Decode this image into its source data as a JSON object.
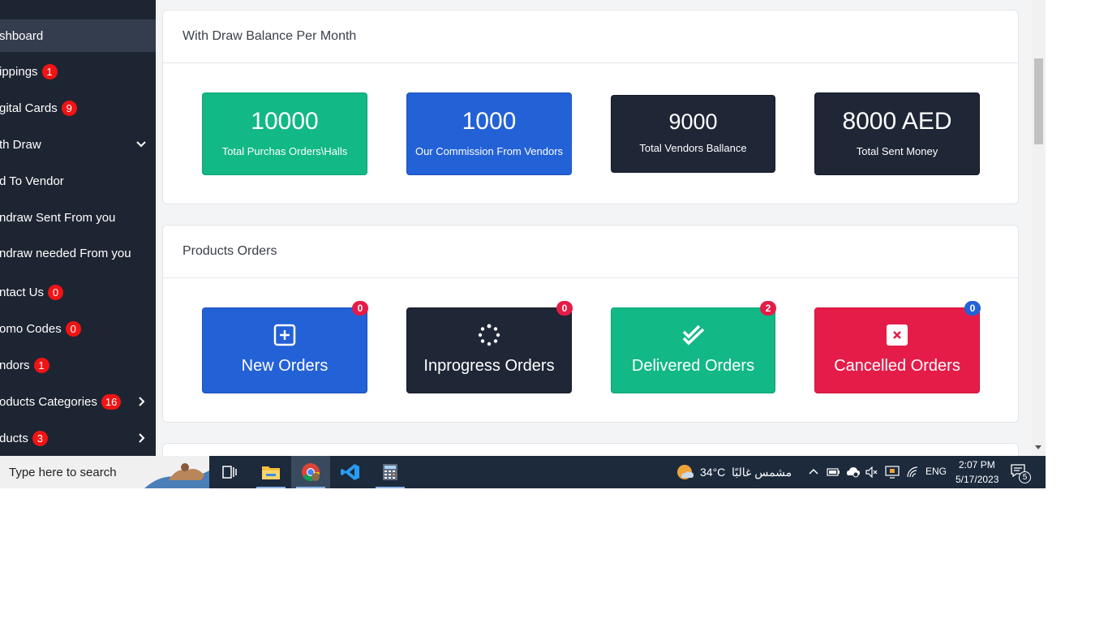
{
  "sidebar": {
    "items": [
      {
        "label": "shboard",
        "badge": "",
        "active": true,
        "chevron": ""
      },
      {
        "label": "ippings",
        "badge": "1",
        "chevron": ""
      },
      {
        "label": "gital Cards",
        "badge": "9",
        "chevron": ""
      },
      {
        "label": "th Draw",
        "badge": "",
        "chevron": "down"
      },
      {
        "label": "d To Vendor",
        "badge": "",
        "chevron": ""
      },
      {
        "label": "ndraw Sent From you",
        "badge": "",
        "chevron": ""
      },
      {
        "label": "ndraw needed From you",
        "badge": "",
        "chevron": ""
      },
      {
        "label": "ntact Us",
        "badge": "0",
        "chevron": ""
      },
      {
        "label": "omo Codes",
        "badge": "0",
        "chevron": ""
      },
      {
        "label": "ndors",
        "badge": "1",
        "chevron": ""
      },
      {
        "label": "oducts Categories",
        "badge": "16",
        "chevron": "right"
      },
      {
        "label": "ducts",
        "badge": "3",
        "chevron": "right"
      }
    ]
  },
  "withdraw": {
    "title": "With Draw Balance Per Month",
    "tiles": [
      {
        "value": "10000",
        "caption": "Total Purchas Orders\\Halls",
        "color": "green"
      },
      {
        "value": "1000",
        "caption": "Our Commission From Vendors",
        "color": "blue"
      },
      {
        "value": "9000",
        "caption": "Total Vendors Ballance",
        "color": "dark"
      },
      {
        "value": "8000 AED",
        "caption": "Total Sent Money",
        "color": "dark"
      }
    ]
  },
  "orders": {
    "title": "Products Orders",
    "tiles": [
      {
        "label": "New Orders",
        "count": "0",
        "color": "blue",
        "badge_color": "#e51c48",
        "icon": "plus-square-icon"
      },
      {
        "label": "Inprogress Orders",
        "count": "0",
        "color": "dark",
        "badge_color": "#e51c48",
        "icon": "spinner-icon"
      },
      {
        "label": "Delivered Orders",
        "count": "2",
        "color": "green",
        "badge_color": "#e51c48",
        "icon": "double-check-icon"
      },
      {
        "label": "Cancelled Orders",
        "count": "0",
        "color": "red",
        "badge_color": "#2361d6",
        "icon": "x-square-icon"
      }
    ]
  },
  "taskbar": {
    "search_placeholder": "Type here to search",
    "apps": [
      "task-view-icon",
      "file-explorer-icon",
      "chrome-icon",
      "vscode-icon",
      "calculator-icon"
    ],
    "weather_temp": "34°C",
    "weather_text": "مشمس غالبًا",
    "language": "ENG",
    "time": "2:07 PM",
    "date": "5/17/2023",
    "notification_count": "5"
  },
  "colors": {
    "sidebar_bg": "#1e2532",
    "green": "#12b886",
    "blue": "#2361d6",
    "dark": "#1f2636",
    "red": "#e51c48",
    "taskbar_bg": "#1c2a3c"
  }
}
